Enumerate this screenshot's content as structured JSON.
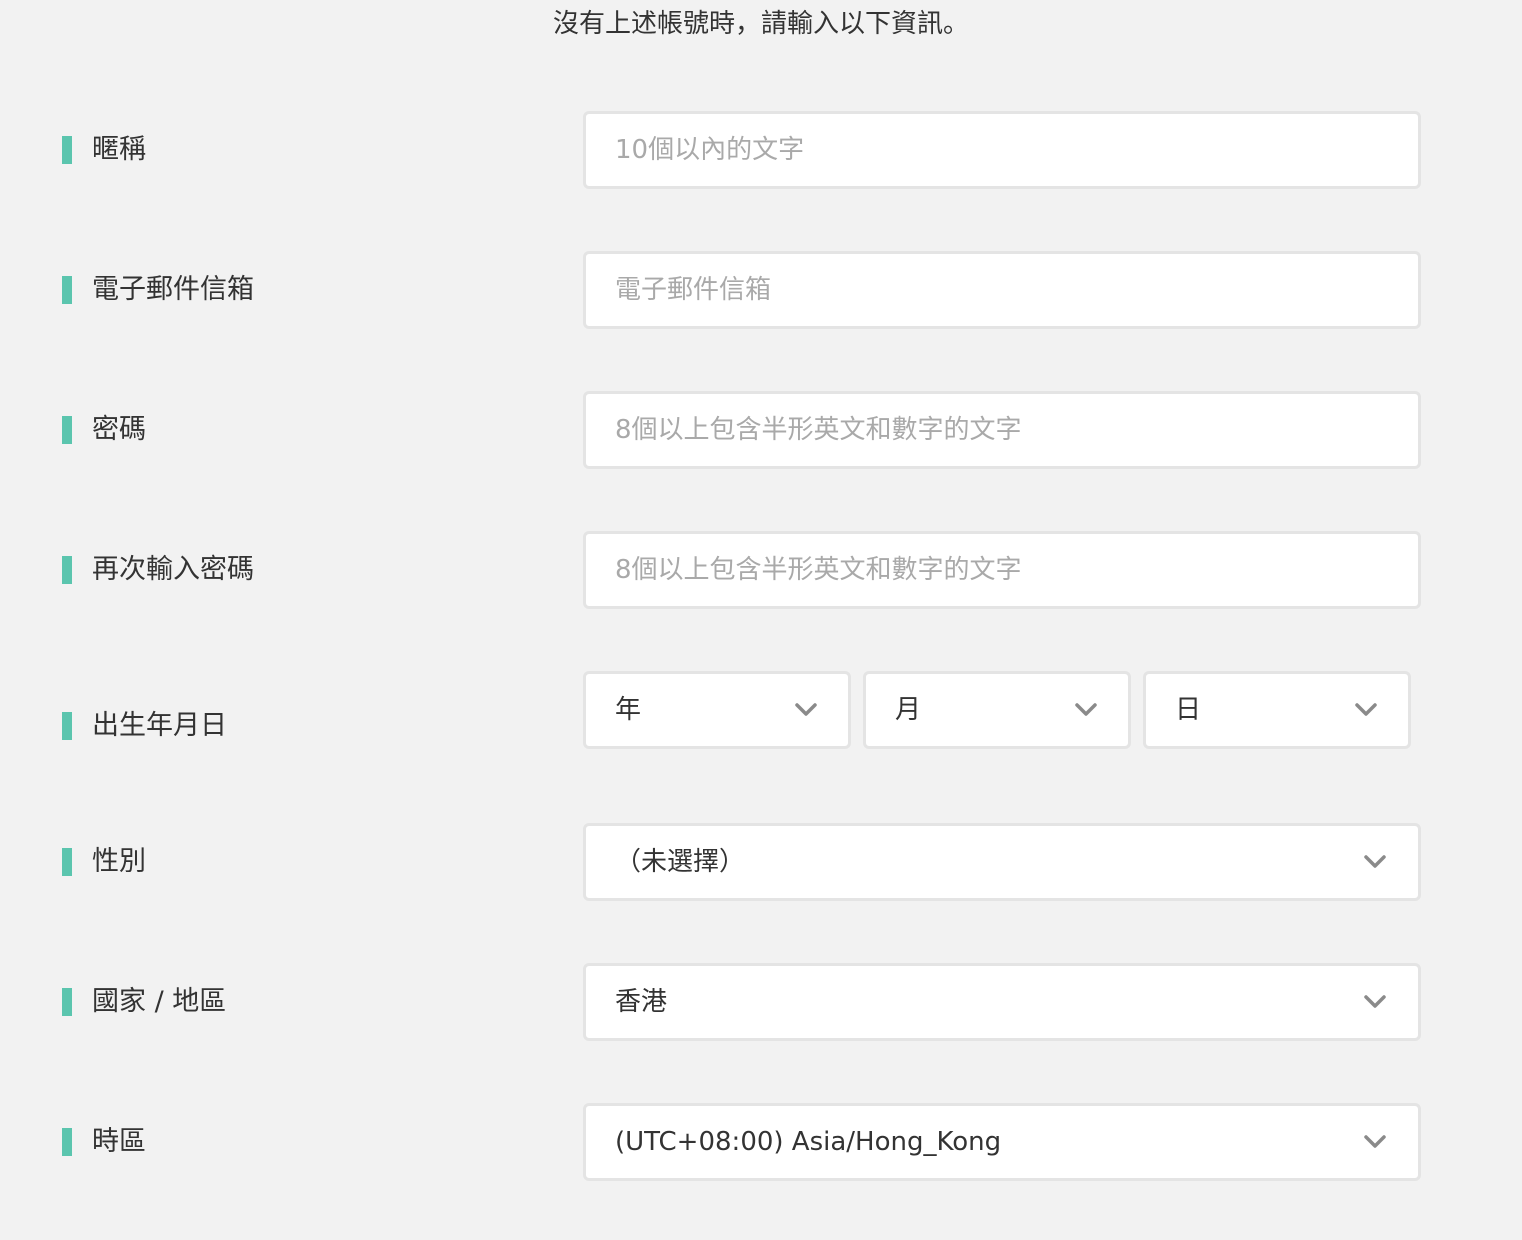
{
  "intro": "沒有上述帳號時，請輸入以下資訊。",
  "nickname": {
    "label": "暱稱",
    "placeholder": "10個以內的文字"
  },
  "email": {
    "label": "電子郵件信箱",
    "placeholder": "電子郵件信箱"
  },
  "password": {
    "label": "密碼",
    "placeholder": "8個以上包含半形英文和數字的文字"
  },
  "password_confirm": {
    "label": "再次輸入密碼",
    "placeholder": "8個以上包含半形英文和數字的文字"
  },
  "birthday": {
    "label": "出生年月日",
    "year": "年",
    "month": "月",
    "day": "日"
  },
  "gender": {
    "label": "性別",
    "value": "（未選擇）"
  },
  "country": {
    "label": "國家 / 地區",
    "value": "香港"
  },
  "timezone": {
    "label": "時區",
    "value": "(UTC+08:00) Asia/Hong_Kong"
  },
  "colors": {
    "accent": "#5bc5ae",
    "background": "#f2f2f2",
    "field_border": "#e4e4e4"
  },
  "icons": {
    "select_arrow": "chevron-down-icon"
  }
}
